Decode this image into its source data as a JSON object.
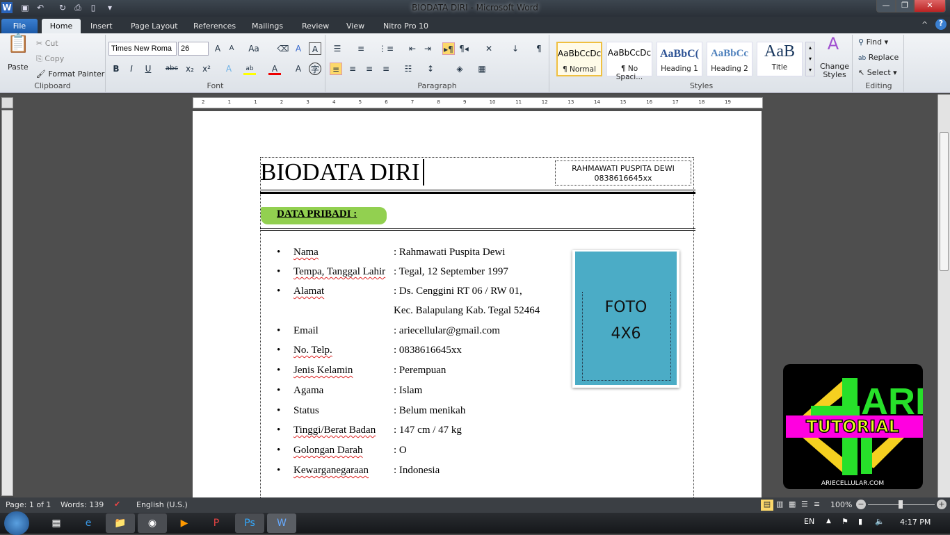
{
  "window": {
    "title": "BIODATA DIRI  -  Microsoft Word"
  },
  "tabs": [
    "File",
    "Home",
    "Insert",
    "Page Layout",
    "References",
    "Mailings",
    "Review",
    "View",
    "Nitro Pro 10"
  ],
  "ribbon": {
    "clipboard": {
      "label": "Clipboard",
      "paste": "Paste",
      "cut": "Cut",
      "copy": "Copy",
      "format_painter": "Format Painter"
    },
    "font": {
      "label": "Font",
      "font_name": "Times New Roma",
      "font_size": "26"
    },
    "paragraph": {
      "label": "Paragraph"
    },
    "styles": {
      "label": "Styles",
      "items": [
        {
          "preview": "AaBbCcDc",
          "name": "¶ Normal"
        },
        {
          "preview": "AaBbCcDc",
          "name": "¶ No Spaci..."
        },
        {
          "preview": "AaBbC(",
          "name": "Heading 1"
        },
        {
          "preview": "AaBbCc",
          "name": "Heading 2"
        },
        {
          "preview": "AaB",
          "name": "Title"
        }
      ],
      "change_styles": "Change Styles"
    },
    "editing": {
      "label": "Editing",
      "find": "Find",
      "replace": "Replace",
      "select": "Select"
    }
  },
  "ruler": {
    "ticks": [
      "2",
      "1",
      "1",
      "2",
      "3",
      "4",
      "5",
      "6",
      "7",
      "8",
      "9",
      "10",
      "11",
      "12",
      "13",
      "14",
      "15",
      "16",
      "17",
      "18",
      "19"
    ]
  },
  "document": {
    "title": "BIODATA DIRI",
    "header_box": {
      "name": "RAHMAWATI PUSPITA DEWI",
      "phone": "0838616645xx"
    },
    "section": "DATA PRIBADI :",
    "fields": [
      {
        "label": "Nama",
        "value": ": Rahmawati Puspita Dewi"
      },
      {
        "label": "Tempa, Tanggal  Lahir",
        "value": ": Tegal,  12 September 1997"
      },
      {
        "label": "Alamat",
        "value": ": Ds. Cenggini RT 06 / RW 01,"
      },
      {
        "label": "",
        "value": "  Kec. Balapulang Kab. Tegal  52464"
      },
      {
        "label": "Email",
        "value": ": ariecellular@gmail.com"
      },
      {
        "label": "No. Telp.",
        "value": ": 0838616645xx"
      },
      {
        "label": "Jenis Kelamin",
        "value": ": Perempuan"
      },
      {
        "label": "Agama",
        "value": ": Islam"
      },
      {
        "label": "Status",
        "value": ": Belum menikah"
      },
      {
        "label": "Tinggi/Berat  Badan",
        "value": ": 147 cm  / 47 kg"
      },
      {
        "label": "Golongan Darah",
        "value": ": O"
      },
      {
        "label": "Kewarganegaraan",
        "value": ": Indonesia"
      }
    ],
    "photo": {
      "line1": "FOTO",
      "line2": "4X6"
    },
    "colors": {
      "section_bg": "#92d050",
      "photo_bg": "#4bacc6"
    }
  },
  "watermark": {
    "text1": "ARIE",
    "text2": "TUTORIAL",
    "site": "ARIECELLULAR.COM"
  },
  "statusbar": {
    "page": "Page: 1 of 1",
    "words": "Words: 139",
    "language": "English (U.S.)",
    "zoom": "100%"
  },
  "taskbar": {
    "lang": "EN",
    "time": "4:17 PM"
  }
}
